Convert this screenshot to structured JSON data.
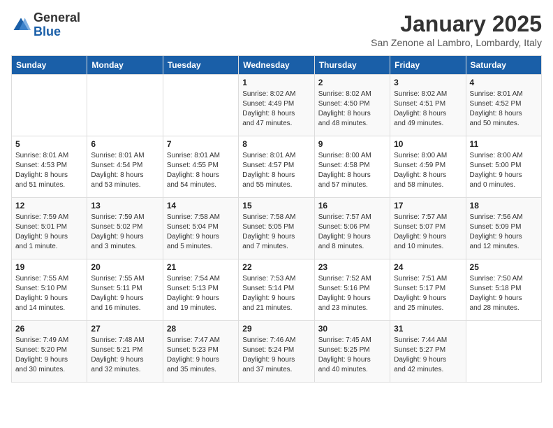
{
  "logo": {
    "general": "General",
    "blue": "Blue"
  },
  "title": "January 2025",
  "location": "San Zenone al Lambro, Lombardy, Italy",
  "days_header": [
    "Sunday",
    "Monday",
    "Tuesday",
    "Wednesday",
    "Thursday",
    "Friday",
    "Saturday"
  ],
  "weeks": [
    [
      {
        "day": "",
        "content": ""
      },
      {
        "day": "",
        "content": ""
      },
      {
        "day": "",
        "content": ""
      },
      {
        "day": "1",
        "content": "Sunrise: 8:02 AM\nSunset: 4:49 PM\nDaylight: 8 hours\nand 47 minutes."
      },
      {
        "day": "2",
        "content": "Sunrise: 8:02 AM\nSunset: 4:50 PM\nDaylight: 8 hours\nand 48 minutes."
      },
      {
        "day": "3",
        "content": "Sunrise: 8:02 AM\nSunset: 4:51 PM\nDaylight: 8 hours\nand 49 minutes."
      },
      {
        "day": "4",
        "content": "Sunrise: 8:01 AM\nSunset: 4:52 PM\nDaylight: 8 hours\nand 50 minutes."
      }
    ],
    [
      {
        "day": "5",
        "content": "Sunrise: 8:01 AM\nSunset: 4:53 PM\nDaylight: 8 hours\nand 51 minutes."
      },
      {
        "day": "6",
        "content": "Sunrise: 8:01 AM\nSunset: 4:54 PM\nDaylight: 8 hours\nand 53 minutes."
      },
      {
        "day": "7",
        "content": "Sunrise: 8:01 AM\nSunset: 4:55 PM\nDaylight: 8 hours\nand 54 minutes."
      },
      {
        "day": "8",
        "content": "Sunrise: 8:01 AM\nSunset: 4:57 PM\nDaylight: 8 hours\nand 55 minutes."
      },
      {
        "day": "9",
        "content": "Sunrise: 8:00 AM\nSunset: 4:58 PM\nDaylight: 8 hours\nand 57 minutes."
      },
      {
        "day": "10",
        "content": "Sunrise: 8:00 AM\nSunset: 4:59 PM\nDaylight: 8 hours\nand 58 minutes."
      },
      {
        "day": "11",
        "content": "Sunrise: 8:00 AM\nSunset: 5:00 PM\nDaylight: 9 hours\nand 0 minutes."
      }
    ],
    [
      {
        "day": "12",
        "content": "Sunrise: 7:59 AM\nSunset: 5:01 PM\nDaylight: 9 hours\nand 1 minute."
      },
      {
        "day": "13",
        "content": "Sunrise: 7:59 AM\nSunset: 5:02 PM\nDaylight: 9 hours\nand 3 minutes."
      },
      {
        "day": "14",
        "content": "Sunrise: 7:58 AM\nSunset: 5:04 PM\nDaylight: 9 hours\nand 5 minutes."
      },
      {
        "day": "15",
        "content": "Sunrise: 7:58 AM\nSunset: 5:05 PM\nDaylight: 9 hours\nand 7 minutes."
      },
      {
        "day": "16",
        "content": "Sunrise: 7:57 AM\nSunset: 5:06 PM\nDaylight: 9 hours\nand 8 minutes."
      },
      {
        "day": "17",
        "content": "Sunrise: 7:57 AM\nSunset: 5:07 PM\nDaylight: 9 hours\nand 10 minutes."
      },
      {
        "day": "18",
        "content": "Sunrise: 7:56 AM\nSunset: 5:09 PM\nDaylight: 9 hours\nand 12 minutes."
      }
    ],
    [
      {
        "day": "19",
        "content": "Sunrise: 7:55 AM\nSunset: 5:10 PM\nDaylight: 9 hours\nand 14 minutes."
      },
      {
        "day": "20",
        "content": "Sunrise: 7:55 AM\nSunset: 5:11 PM\nDaylight: 9 hours\nand 16 minutes."
      },
      {
        "day": "21",
        "content": "Sunrise: 7:54 AM\nSunset: 5:13 PM\nDaylight: 9 hours\nand 19 minutes."
      },
      {
        "day": "22",
        "content": "Sunrise: 7:53 AM\nSunset: 5:14 PM\nDaylight: 9 hours\nand 21 minutes."
      },
      {
        "day": "23",
        "content": "Sunrise: 7:52 AM\nSunset: 5:16 PM\nDaylight: 9 hours\nand 23 minutes."
      },
      {
        "day": "24",
        "content": "Sunrise: 7:51 AM\nSunset: 5:17 PM\nDaylight: 9 hours\nand 25 minutes."
      },
      {
        "day": "25",
        "content": "Sunrise: 7:50 AM\nSunset: 5:18 PM\nDaylight: 9 hours\nand 28 minutes."
      }
    ],
    [
      {
        "day": "26",
        "content": "Sunrise: 7:49 AM\nSunset: 5:20 PM\nDaylight: 9 hours\nand 30 minutes."
      },
      {
        "day": "27",
        "content": "Sunrise: 7:48 AM\nSunset: 5:21 PM\nDaylight: 9 hours\nand 32 minutes."
      },
      {
        "day": "28",
        "content": "Sunrise: 7:47 AM\nSunset: 5:23 PM\nDaylight: 9 hours\nand 35 minutes."
      },
      {
        "day": "29",
        "content": "Sunrise: 7:46 AM\nSunset: 5:24 PM\nDaylight: 9 hours\nand 37 minutes."
      },
      {
        "day": "30",
        "content": "Sunrise: 7:45 AM\nSunset: 5:25 PM\nDaylight: 9 hours\nand 40 minutes."
      },
      {
        "day": "31",
        "content": "Sunrise: 7:44 AM\nSunset: 5:27 PM\nDaylight: 9 hours\nand 42 minutes."
      },
      {
        "day": "",
        "content": ""
      }
    ]
  ]
}
